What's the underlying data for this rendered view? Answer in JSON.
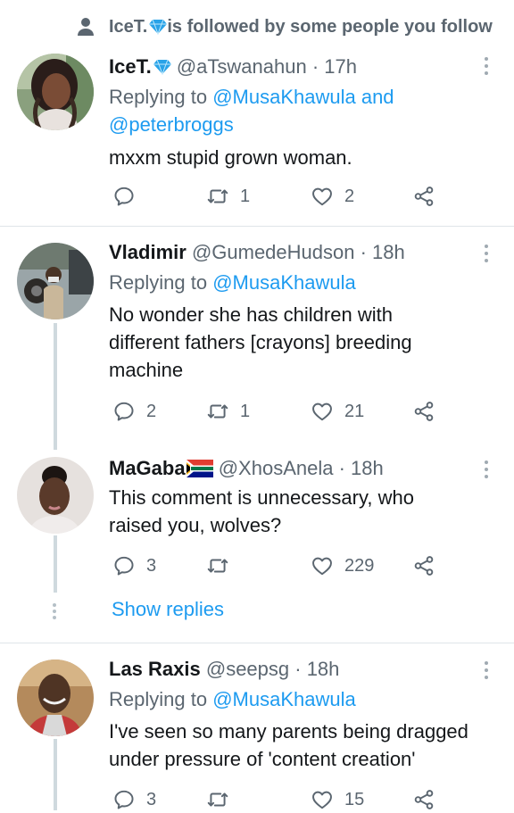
{
  "social_context": {
    "text": " is followed by some people you follow",
    "name": "IceT."
  },
  "tweets": [
    {
      "name": "IceT.",
      "handle": "@aTswanahun",
      "time": " · 17h",
      "replying_label": "Replying to ",
      "replying_to": [
        "@MusaKhawula",
        " and",
        "@peterbroggs"
      ],
      "text": "mxxm stupid grown woman.",
      "reply_count": "",
      "retweet_count": "1",
      "like_count": "2"
    },
    {
      "name": "Vladimir",
      "handle": "@GumedeHudson",
      "time": " · 18h",
      "replying_label": "Replying to ",
      "replying_to": [
        "@MusaKhawula"
      ],
      "text_lines": [
        "No wonder she has children with",
        "different fathers [crayons] breeding",
        "machine"
      ],
      "reply_count": "2",
      "retweet_count": "1",
      "like_count": "21"
    },
    {
      "name": "MaGaba",
      "handle": "@XhosAnela",
      "time": " · 18h",
      "text_lines": [
        "This comment is unnecessary, who",
        "raised you, wolves?"
      ],
      "reply_count": "3",
      "retweet_count": "",
      "like_count": "229"
    },
    {
      "name": "Las Raxis",
      "handle": "@seepsg",
      "time": " · 18h",
      "replying_label": "Replying to ",
      "replying_to": [
        "@MusaKhawula"
      ],
      "text_lines": [
        "I've seen so many parents being dragged",
        "under pressure of 'content creation'"
      ],
      "reply_count": "3",
      "retweet_count": "",
      "like_count": "15"
    }
  ],
  "show_replies": "Show replies",
  "colors": {
    "link": "#1d9bf0",
    "secondary": "#5b6670",
    "text": "#14171a",
    "thread_line": "#cfd9de"
  }
}
